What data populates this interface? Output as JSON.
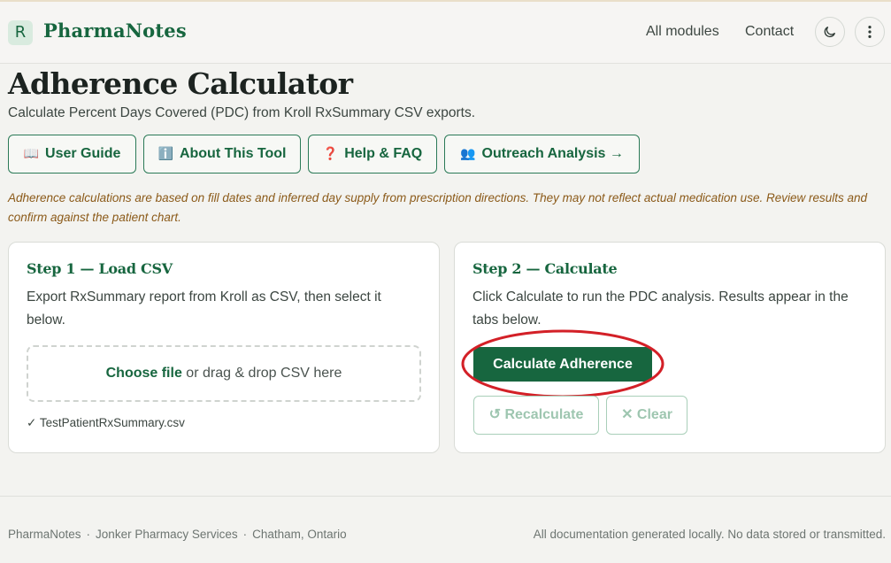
{
  "header": {
    "logo_letter": "R",
    "brand": "PharmaNotes",
    "nav": [
      "All modules",
      "Contact"
    ],
    "theme_icon": "moon-icon",
    "menu_icon": "kebab-menu-icon"
  },
  "page": {
    "title": "Adherence Calculator",
    "subtitle": "Calculate Percent Days Covered (PDC) from Kroll RxSummary CSV exports."
  },
  "buttons": [
    {
      "icon": "📖",
      "icon_name": "book-icon",
      "label": "User Guide"
    },
    {
      "icon": "ℹ️",
      "icon_name": "info-icon",
      "label": "About This Tool"
    },
    {
      "icon": "❓",
      "icon_name": "question-icon",
      "label": "Help & FAQ"
    },
    {
      "icon": "👥",
      "icon_name": "people-icon",
      "label": "Outreach Analysis →"
    }
  ],
  "disclaimer": "Adherence calculations are based on fill dates and inferred day supply from prescription directions. They may not reflect actual medication use. Review results and confirm against the patient chart.",
  "step1": {
    "title": "Step 1 — Load CSV",
    "desc": "Export RxSummary report from Kroll as CSV, then select it below.",
    "dropzone_link": "Choose file",
    "dropzone_text": "or drag & drop CSV here",
    "file_status": "✓ TestPatientRxSummary.csv"
  },
  "step2": {
    "title": "Step 2 — Calculate",
    "desc": "Click Calculate to run the PDC analysis. Results appear in the tabs below.",
    "calculate_label": "Calculate Adherence",
    "recalculate_label": "↺ Recalculate",
    "clear_label": "✕ Clear"
  },
  "footer": {
    "left": [
      "PharmaNotes",
      "Jonker Pharmacy Services",
      "Chatham, Ontario"
    ],
    "separator": "·",
    "right": "All documentation generated locally. No data stored or transmitted."
  },
  "colors": {
    "brand_green": "#17663f",
    "disclaimer": "#8b5a19",
    "annotation_red": "#d32027",
    "background": "#f3f3f0"
  }
}
